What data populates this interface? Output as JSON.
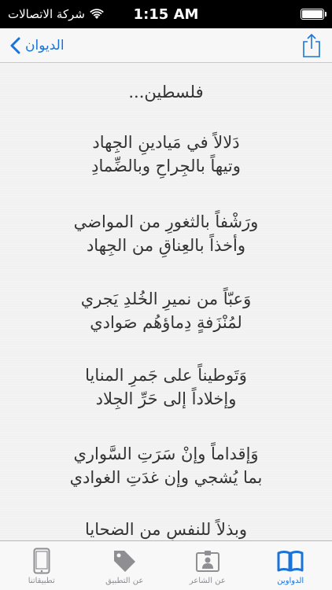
{
  "status_bar": {
    "carrier": "شركة الاتصالات",
    "time": "1:15 AM",
    "battery_level": 1.0
  },
  "nav": {
    "back_label": "الديوان",
    "share_icon": "share-icon",
    "back_icon": "chevron-left-icon"
  },
  "poem": {
    "title": "فلسطين...",
    "stanzas": [
      [
        "دَلالاً في مَيادينِ الجِهاد",
        "وتيهاً بالجِراحِ وبالضِّمادِ"
      ],
      [
        "ورَشْفاً بالثغورِ من المواضي",
        "وأخذاً بالعِناقِ من الجِهاد"
      ],
      [
        "وَعبّاً من نميرِ الخُلدِ يَجري",
        "لمُنْزَفةٍ دِماؤهُم صَوادي"
      ],
      [
        "وَتَوطيناً على جَمرِ المنايا",
        "وإخلاداً إلى حَرِّ الجِلاد"
      ],
      [
        "وَإقداماً وإنْ سَرَتِ السَّواري",
        "بما يُشجي وإن غدَتِ الغوادي"
      ],
      [
        "وبذلاً للنفسِ من الضحايا",
        ""
      ]
    ]
  },
  "tabs": [
    {
      "label": "الدواوين",
      "icon": "book-icon",
      "active": true
    },
    {
      "label": "عن الشاعر",
      "icon": "contact-card-icon",
      "active": false
    },
    {
      "label": "عن التطبيق",
      "icon": "tag-icon",
      "active": false
    },
    {
      "label": "تطبيقاتنا",
      "icon": "phone-icon",
      "active": false
    }
  ],
  "colors": {
    "accent": "#1a73d8",
    "inactive": "#8e8e93"
  }
}
